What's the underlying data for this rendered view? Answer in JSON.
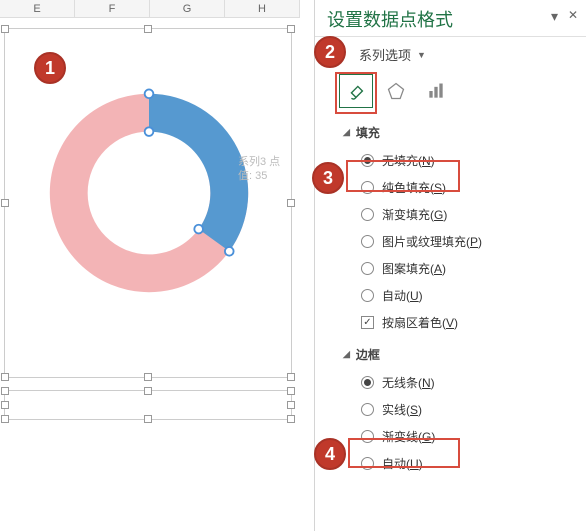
{
  "ruler": [
    "E",
    "F",
    "G",
    "H"
  ],
  "panel": {
    "title": "设置数据点格式",
    "dropdown": "系列选项",
    "tabs": {
      "fill_icon": "fill-effects-icon",
      "pentagon_icon": "effects-icon",
      "bars_icon": "series-options-icon"
    },
    "fill_section": {
      "title": "填充",
      "options": [
        {
          "label": "无填充(",
          "key": "N",
          "suffix": ")",
          "selected": true,
          "type": "radio"
        },
        {
          "label": "纯色填充(",
          "key": "S",
          "suffix": ")",
          "selected": false,
          "type": "radio"
        },
        {
          "label": "渐变填充(",
          "key": "G",
          "suffix": ")",
          "selected": false,
          "type": "radio"
        },
        {
          "label": "图片或纹理填充(",
          "key": "P",
          "suffix": ")",
          "selected": false,
          "type": "radio"
        },
        {
          "label": "图案填充(",
          "key": "A",
          "suffix": ")",
          "selected": false,
          "type": "radio"
        },
        {
          "label": "自动(",
          "key": "U",
          "suffix": ")",
          "selected": false,
          "type": "radio"
        },
        {
          "label": "按扇区着色(",
          "key": "V",
          "suffix": ")",
          "selected": true,
          "type": "checkbox"
        }
      ]
    },
    "border_section": {
      "title": "边框",
      "options": [
        {
          "label": "无线条(",
          "key": "N",
          "suffix": ")",
          "selected": true,
          "type": "radio"
        },
        {
          "label": "实线(",
          "key": "S",
          "suffix": ")",
          "selected": false,
          "type": "radio"
        },
        {
          "label": "渐变线(",
          "key": "G",
          "suffix": ")",
          "selected": false,
          "type": "radio"
        },
        {
          "label": "自动(",
          "key": "U",
          "suffix": ")",
          "selected": false,
          "type": "radio"
        }
      ]
    }
  },
  "tooltip": {
    "line1": "系列3 点",
    "line2": "值: 35"
  },
  "badges": [
    "1",
    "2",
    "3",
    "4"
  ],
  "chart_data": {
    "type": "pie",
    "subtype": "doughnut",
    "series": [
      {
        "name": "系列3",
        "values": [
          35,
          65
        ],
        "colors": [
          "#5699d0",
          "#f3b4b6"
        ]
      }
    ],
    "selected_point": 0,
    "hole_ratio": 0.62
  }
}
